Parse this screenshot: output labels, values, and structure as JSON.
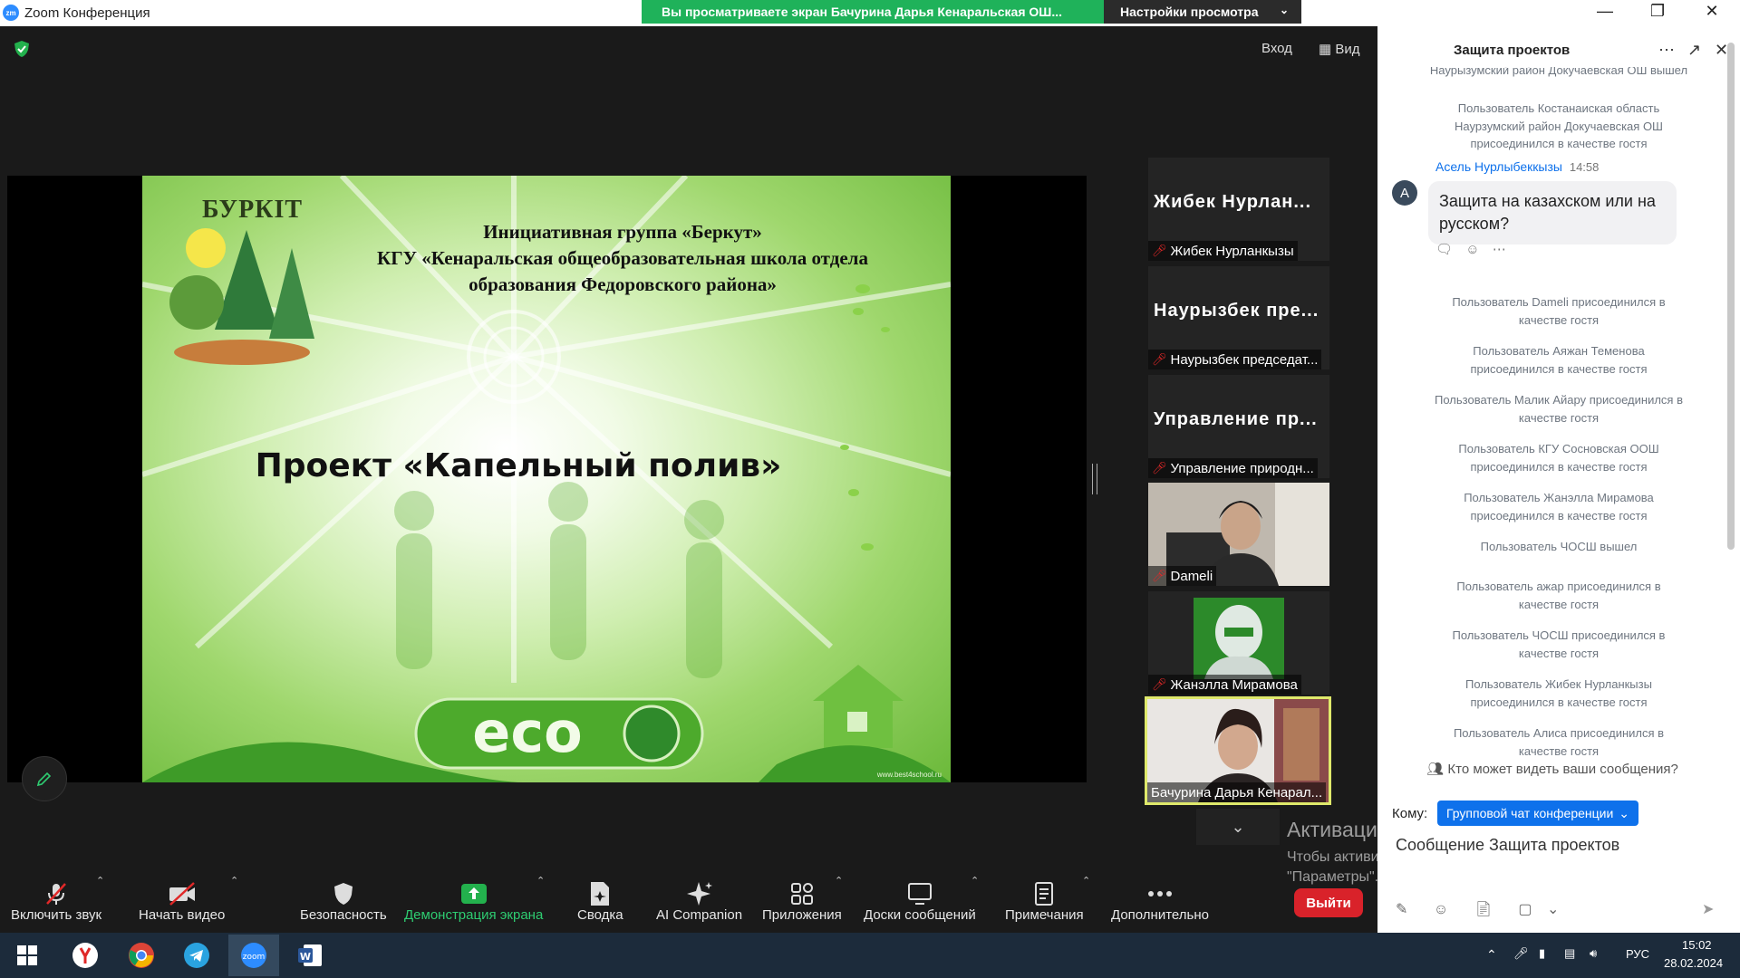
{
  "window": {
    "title": "Zoom Конференция",
    "logo": "zm"
  },
  "share_banner": {
    "text": "Вы просматриваете экран Бачурина Дарья Кенаральская ОШ...",
    "view_settings": "Настройки просмотра"
  },
  "top_controls": {
    "enter": "Вход",
    "view": "Вид"
  },
  "slide": {
    "logo_text": "БУРКІТ",
    "heading_lines": [
      "Инициативная группа «Беркут»",
      "КГУ «Кенаральская общеобразовательная школа отдела",
      "образования Федоровского района»"
    ],
    "title": "Проект «Капельный полив»",
    "eco_text": "eco",
    "credit": "www.best4school.ru"
  },
  "participants": [
    {
      "big_name": "Жибек Нурлан...",
      "label": "Жибек Нурланкызы",
      "video": false
    },
    {
      "big_name": "Наурызбек пре...",
      "label": "Наурызбек председат...",
      "video": false
    },
    {
      "big_name": "Управление пр...",
      "label": "Управление природн...",
      "video": false
    },
    {
      "big_name": "",
      "label": "Dameli",
      "video": true
    },
    {
      "big_name": "",
      "label": "Жанэлла Мирамова",
      "video": true
    },
    {
      "big_name": "",
      "label": "Бачурина Дарья Кенарал...",
      "video": true,
      "active": true
    }
  ],
  "toolbar": {
    "audio": "Включить звук",
    "video": "Начать видео",
    "security": "Безопасность",
    "share": "Демонстрация экрана",
    "summary": "Сводка",
    "ai": "AI Companion",
    "apps": "Приложения",
    "boards": "Доски сообщений",
    "notes": "Примечания",
    "more": "Дополнительно",
    "leave": "Выйти"
  },
  "activation": {
    "title": "Активация Windows",
    "line1": "Чтобы активировать Windows, перейдите в раздел",
    "line2": "\"Параметры\"."
  },
  "chat": {
    "title": "Защита проектов",
    "cut_top": "Наурызумский район Докучаевская ОШ вышел",
    "system_top": [
      "Пользователь Костанаиская область",
      "Наурзумский район Докучаевская ОШ",
      "присоединился в качестве гостя"
    ],
    "message": {
      "sender": "Асель Нурлыбеккызы",
      "time": "14:58",
      "avatar": "А",
      "text": "Защита на казахском или на русском?"
    },
    "system_messages": [
      [
        "Пользователь Dameli присоединился в",
        "качестве гостя"
      ],
      [
        "Пользователь Аяжан Теменова",
        "присоединился в качестве гостя"
      ],
      [
        "Пользователь Малик Айару присоединился в",
        "качестве гостя"
      ],
      [
        "Пользователь КГУ Сосновская ООШ",
        "присоединился в качестве гостя"
      ],
      [
        "Пользователь Жанэлла Мирамова",
        "присоединился в качестве гостя"
      ],
      [
        "Пользователь ЧОСШ вышел"
      ],
      [
        "Пользователь ажар присоединился в",
        "качестве гостя"
      ],
      [
        "Пользователь ЧОСШ присоединился в",
        "качестве гостя"
      ],
      [
        "Пользователь Жибек Нурланкызы",
        "присоединился в качестве гостя"
      ],
      [
        "Пользователь Алиса присоединился в",
        "качестве гостя"
      ]
    ],
    "who_can_see": "Кто может видеть ваши сообщения?",
    "to_label": "Кому:",
    "to_value": "Групповой чат конференции",
    "input_placeholder": "Сообщение Защита проектов"
  },
  "taskbar": {
    "lang": "РУС",
    "time": "15:02",
    "date": "28.02.2024"
  },
  "colors": {
    "accent": "#0e71eb",
    "share_green": "#1fb25a",
    "leave_red": "#d9222a",
    "mic_red": "#e02828"
  }
}
